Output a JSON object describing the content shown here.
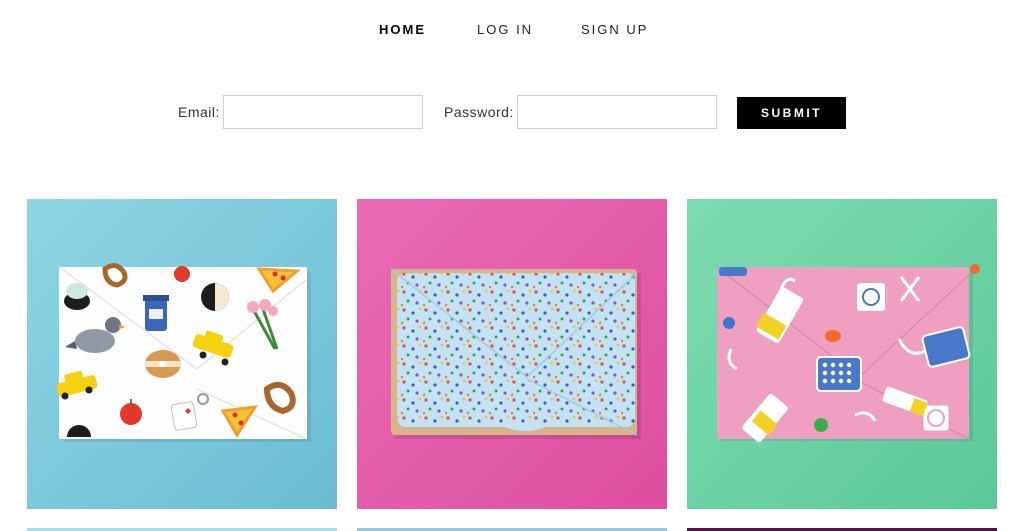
{
  "nav": {
    "items": [
      {
        "label": "HOME",
        "active": true
      },
      {
        "label": "LOG IN",
        "active": false
      },
      {
        "label": "SIGN UP",
        "active": false
      }
    ]
  },
  "login_form": {
    "email_label": "Email:",
    "email_value": "",
    "email_placeholder": "",
    "password_label": "Password:",
    "password_value": "",
    "password_placeholder": "",
    "submit_label": "SUBMIT"
  },
  "gallery": {
    "items": [
      {
        "image": "nyc-icons-envelope-on-blue",
        "background": "#7ccbdc",
        "envelope": "#ffffff"
      },
      {
        "image": "sprinkles-envelope-on-pink",
        "background": "#e45cae",
        "envelope": "#c9ecf7"
      },
      {
        "image": "birth-control-envelope-on-mint",
        "background": "#6ed3a4",
        "envelope": "#ef9fc0"
      }
    ]
  },
  "colors": {
    "button_bg": "#000000",
    "button_text": "#ffffff",
    "input_border": "#cfcfcf"
  }
}
